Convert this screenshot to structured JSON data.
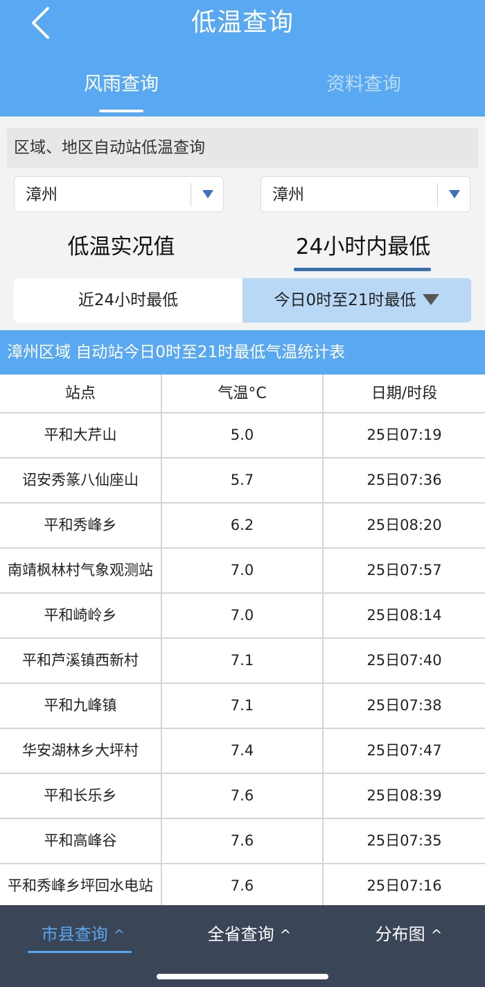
{
  "header": {
    "title": "低温查询",
    "tabs": [
      {
        "label": "风雨查询",
        "active": true
      },
      {
        "label": "资料查询",
        "active": false
      }
    ]
  },
  "query": {
    "section_label": "区域、地区自动站低温查询",
    "select_left": "漳州",
    "select_right": "漳州",
    "modes": [
      {
        "label": "低温实况值",
        "active": false
      },
      {
        "label": "24小时内最低",
        "active": true
      }
    ],
    "ranges": [
      {
        "label": "近24小时最低",
        "selected": false
      },
      {
        "label": "今日0时至21时最低",
        "selected": true
      }
    ]
  },
  "table": {
    "caption": "漳州区域 自动站今日0时至21时最低气温统计表",
    "headers": [
      "站点",
      "气温°C",
      "日期/时段"
    ],
    "rows": [
      [
        "平和大芹山",
        "5.0",
        "25日07:19"
      ],
      [
        "诏安秀篆八仙座山",
        "5.7",
        "25日07:36"
      ],
      [
        "平和秀峰乡",
        "6.2",
        "25日08:20"
      ],
      [
        "南靖枫林村气象观测站",
        "7.0",
        "25日07:57"
      ],
      [
        "平和崎岭乡",
        "7.0",
        "25日08:14"
      ],
      [
        "平和芦溪镇西新村",
        "7.1",
        "25日07:40"
      ],
      [
        "平和九峰镇",
        "7.1",
        "25日07:38"
      ],
      [
        "华安湖林乡大坪村",
        "7.4",
        "25日07:47"
      ],
      [
        "平和长乐乡",
        "7.6",
        "25日08:39"
      ],
      [
        "平和高峰谷",
        "7.6",
        "25日07:35"
      ],
      [
        "平和秀峰乡坪回水电站",
        "7.6",
        "25日07:16"
      ]
    ]
  },
  "bottom_nav": {
    "items": [
      {
        "label": "市县查询",
        "active": true
      },
      {
        "label": "全省查询",
        "active": false
      },
      {
        "label": "分布图",
        "active": false
      }
    ],
    "caret": "^"
  },
  "colors": {
    "header_blue": "#59a9f2",
    "tab_inactive": "#bcdcf9",
    "selected_range": "#b9d8f6",
    "mode_underline": "#3a6fae",
    "nav_bg": "#3b4558",
    "nav_active": "#5aa7ee"
  },
  "icons": {
    "back": "chevron-left-icon",
    "dropdown": "triangle-down-icon",
    "nav_caret": "chevron-up-icon"
  }
}
